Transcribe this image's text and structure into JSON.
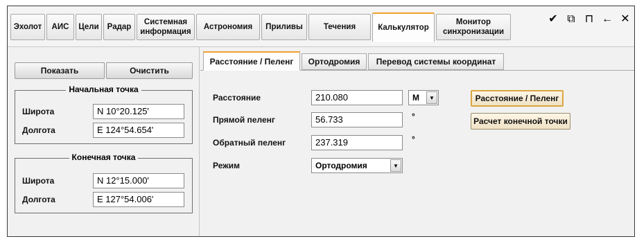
{
  "top_tabs": [
    {
      "label": "Эхолот"
    },
    {
      "label": "АИС"
    },
    {
      "label": "Цели"
    },
    {
      "label": "Радар"
    },
    {
      "label": "Системная\nинформация"
    },
    {
      "label": "Астрономия"
    },
    {
      "label": "Приливы"
    },
    {
      "label": "Течения"
    },
    {
      "label": "Калькулятор",
      "active": true
    },
    {
      "label": "Монитор\nсинхронизации"
    }
  ],
  "window_tools": [
    {
      "icon": "broom-icon",
      "glyph": "✔"
    },
    {
      "icon": "restore-icon",
      "glyph": "⧉"
    },
    {
      "icon": "pin-icon",
      "glyph": "⊓"
    },
    {
      "icon": "back-arrow-icon",
      "glyph": "←"
    },
    {
      "icon": "close-icon",
      "glyph": "✕"
    }
  ],
  "left": {
    "show_label": "Показать",
    "clear_label": "Очистить",
    "start_group": {
      "title": "Начальная точка",
      "lat_label": "Широта",
      "lat_value": "N 10°20.125'",
      "lon_label": "Долгота",
      "lon_value": "E 124°54.654'"
    },
    "end_group": {
      "title": "Конечная точка",
      "lat_label": "Широта",
      "lat_value": "N 12°15.000'",
      "lon_label": "Долгота",
      "lon_value": "E 127°54.006'"
    }
  },
  "sub_tabs": [
    {
      "label": "Расстояние / Пеленг",
      "active": true
    },
    {
      "label": "Ортодромия"
    },
    {
      "label": "Перевод системы координат"
    }
  ],
  "calc": {
    "distance_label": "Расстояние",
    "distance_value": "210.080",
    "unit_value": "M",
    "forward_label": "Прямой пеленг",
    "forward_value": "56.733",
    "forward_unit": "°",
    "reverse_label": "Обратный пеленг",
    "reverse_value": "237.319",
    "reverse_unit": "°",
    "mode_label": "Режим",
    "mode_value": "Ортодромия",
    "btn_distance_bearing": "Расстояние / Пеленг",
    "btn_endpoint": "Расчет конечной точки"
  },
  "colors": {
    "active_tab_accent": "#f0a030",
    "action_button_bg": "#efe2c4"
  }
}
